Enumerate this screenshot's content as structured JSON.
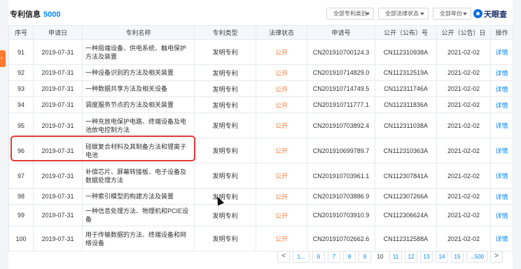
{
  "header": {
    "title": "专利信息",
    "count": "5000",
    "filters": [
      "全部专利类别",
      "全部法律状态",
      "全部年份"
    ],
    "logo_text": "天眼查"
  },
  "columns": [
    "序号",
    "申请日",
    "专利名称",
    "专利类型",
    "法律状态",
    "申请号",
    "公开（公布）号",
    "公开（公告）日",
    "操作"
  ],
  "rows": [
    {
      "no": "91",
      "date": "2019-07-31",
      "name": "一种局端设备、供电系统、触电保护方法及装置",
      "type": "发明专利",
      "status": "公开",
      "app_no": "CN201910700124.3",
      "pub_no": "CN112310938A",
      "pub_date": "2021-02-02",
      "action": "详情"
    },
    {
      "no": "92",
      "date": "2019-07-31",
      "name": "一种设备识别的方法及相关装置",
      "type": "发明专利",
      "status": "公开",
      "app_no": "CN201910714829.0",
      "pub_no": "CN112312519A",
      "pub_date": "2021-02-02",
      "action": "详情"
    },
    {
      "no": "93",
      "date": "2019-07-31",
      "name": "一种数据共享方法及相关设备",
      "type": "发明专利",
      "status": "公开",
      "app_no": "CN201910714749.5",
      "pub_no": "CN112311746A",
      "pub_date": "2021-02-02",
      "action": "详情"
    },
    {
      "no": "94",
      "date": "2019-07-31",
      "name": "调度服务节点的方法及相关装置",
      "type": "发明专利",
      "status": "公开",
      "app_no": "CN201910711777.1",
      "pub_no": "CN112311836A",
      "pub_date": "2021-02-02",
      "action": "详情"
    },
    {
      "no": "95",
      "date": "2019-07-31",
      "name": "一种充放电保护电路、终端设备及电池放电控制方法",
      "type": "发明专利",
      "status": "公开",
      "app_no": "CN201910703892.4",
      "pub_no": "CN112311038A",
      "pub_date": "2021-02-02",
      "action": "详情"
    },
    {
      "no": "96",
      "date": "2019-07-31",
      "name": "硅碳复合材料及其制备方法和锂离子电池",
      "type": "发明专利",
      "status": "公开",
      "app_no": "CN201910699789.7",
      "pub_no": "CN112310363A",
      "pub_date": "2021-02-02",
      "action": "详情"
    },
    {
      "no": "97",
      "date": "2019-07-31",
      "name": "补偿芯片、屏幕转接板、电子设备及数据处理方法",
      "type": "发明专利",
      "status": "公开",
      "app_no": "CN201910703961.1",
      "pub_no": "CN112307841A",
      "pub_date": "2021-02-02",
      "action": "详情"
    },
    {
      "no": "98",
      "date": "2019-07-31",
      "name": "一种索引模型的构建方法及装置",
      "type": "发明专利",
      "status": "公开",
      "app_no": "CN201910703886.9",
      "pub_no": "CN112307266A",
      "pub_date": "2021-02-02",
      "action": "详情"
    },
    {
      "no": "99",
      "date": "2019-07-31",
      "name": "一种信息处理方法、物理机和PCIE设备",
      "type": "发明专利",
      "status": "公开",
      "app_no": "CN201910703910.9",
      "pub_no": "CN112306624A",
      "pub_date": "2021-02-02",
      "action": "详情"
    },
    {
      "no": "100",
      "date": "2019-07-31",
      "name": "用于传输数据的方法、终端设备和网络设备",
      "type": "发明专利",
      "status": "公开",
      "app_no": "CN201910702662.6",
      "pub_no": "CN112312588A",
      "pub_date": "2021-02-02",
      "action": "详情"
    }
  ],
  "pagination": {
    "prev": "<",
    "first": "1...",
    "pages": [
      "6",
      "7",
      "8",
      "9",
      "10",
      "11",
      "12",
      "13",
      "14",
      "15"
    ],
    "current": "10",
    "last": "...500",
    "next": ">"
  },
  "colors": {
    "accent": "#0084ff",
    "status": "#ff7a2e",
    "highlight": "#e53935"
  }
}
